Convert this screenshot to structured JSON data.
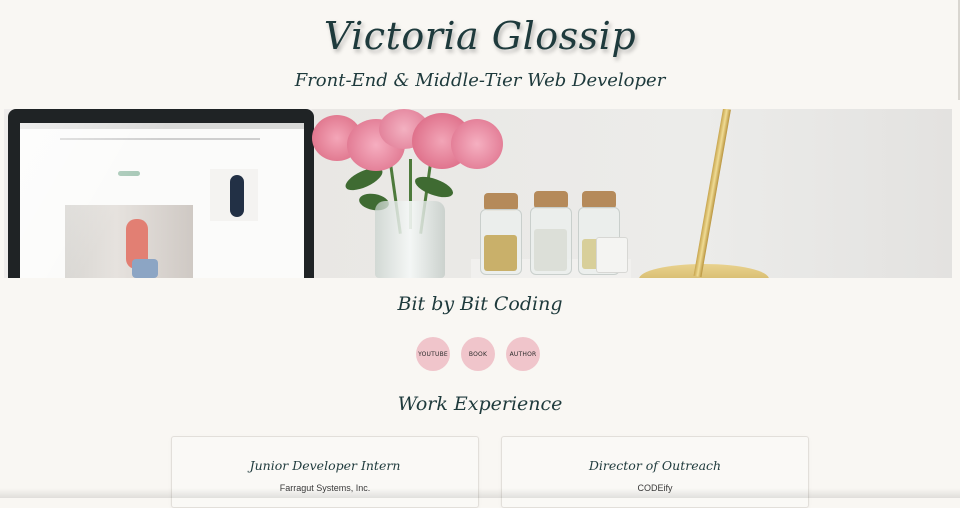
{
  "header": {
    "title": "Victoria Glossip",
    "subtitle": "Front-End & Middle-Tier Web Developer"
  },
  "banner": {
    "image_icon": "workspace-photo-icon"
  },
  "bit_by_bit": {
    "title": "Bit by Bit Coding",
    "buttons": [
      {
        "label": "YOUTUBE"
      },
      {
        "label": "BOOK"
      },
      {
        "label": "AUTHOR"
      }
    ]
  },
  "work_experience": {
    "title": "Work Experience",
    "jobs": [
      {
        "title": "Junior Developer Intern",
        "company": "Farragut Systems, Inc."
      },
      {
        "title": "Director of Outreach",
        "company": "CODEify"
      }
    ]
  },
  "colors": {
    "background": "#f9f7f3",
    "text": "#1e3a3c",
    "button_pink": "#f0c5cb"
  }
}
